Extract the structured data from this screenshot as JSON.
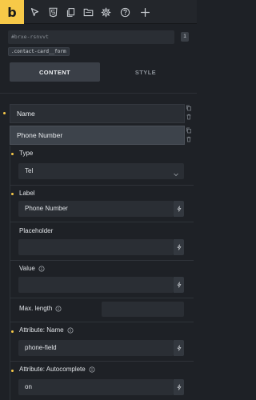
{
  "toolbar": {
    "logo_letter": "b",
    "icons": [
      "cursor-icon",
      "html5-icon",
      "pages-icon",
      "folder-icon",
      "gear-icon",
      "help-icon",
      "plus-icon"
    ]
  },
  "element": {
    "id": "#brxe-rsnvvt",
    "count": "1",
    "class_chip": ".contact-card__form"
  },
  "tabs": {
    "content": "CONTENT",
    "style": "STYLE"
  },
  "items": {
    "name": "Name",
    "phone": "Phone Number"
  },
  "form": {
    "type_label": "Type",
    "type_value": "Tel",
    "label_label": "Label",
    "label_value": "Phone Number",
    "placeholder_label": "Placeholder",
    "placeholder_value": "",
    "value_label": "Value",
    "value_value": "",
    "maxlength_label": "Max. length",
    "maxlength_value": "",
    "attr_name_label": "Attribute: Name",
    "attr_name_value": "phone-field",
    "attr_autocomplete_label": "Attribute: Autocomplete",
    "attr_autocomplete_value": "on"
  },
  "colors": {
    "accent": "#f7c948",
    "background": "#1e2126",
    "field": "#2a2e34"
  }
}
